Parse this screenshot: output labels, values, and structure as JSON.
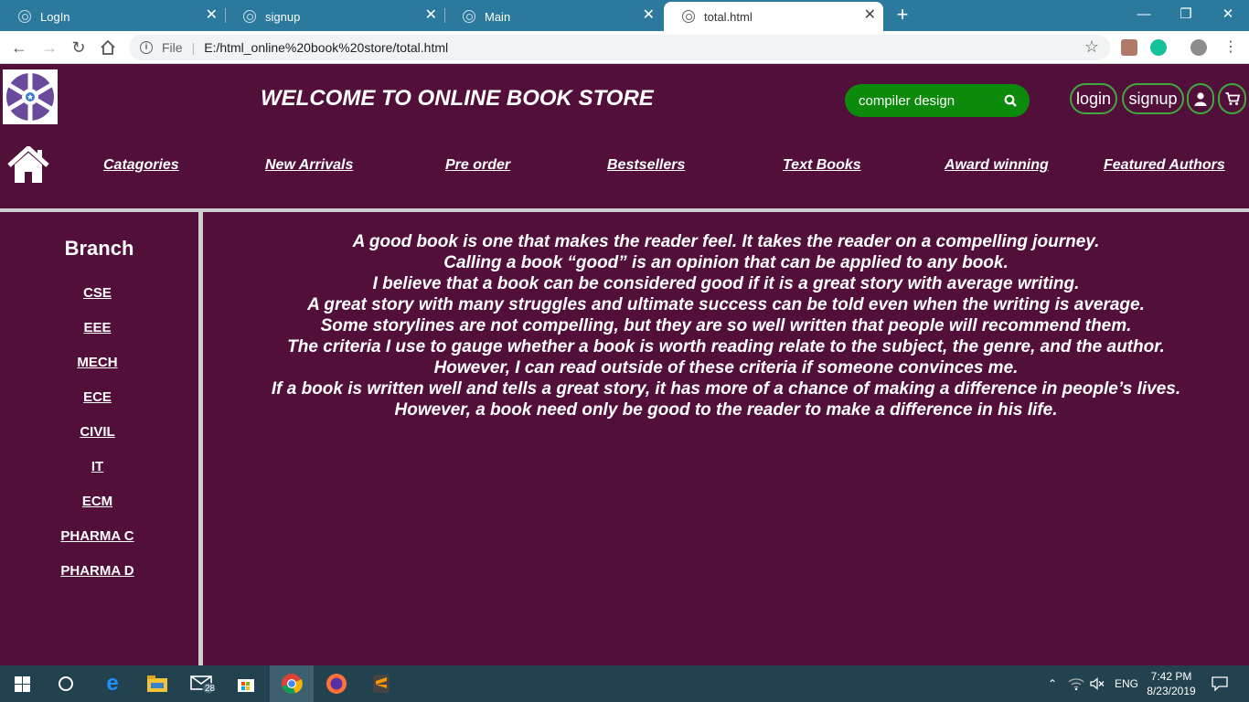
{
  "browser": {
    "tabs": [
      {
        "title": "LogIn",
        "active": false
      },
      {
        "title": "signup",
        "active": false
      },
      {
        "title": "Main",
        "active": false
      },
      {
        "title": "total.html",
        "active": true
      }
    ],
    "address": {
      "protocol_label": "File",
      "url": "E:/html_online%20book%20store/total.html"
    }
  },
  "header": {
    "title": "WELCOME TO ONLINE BOOK STORE",
    "search_value": "compiler design",
    "login_label": "login",
    "signup_label": "signup"
  },
  "nav": {
    "items": [
      {
        "label": "Catagories"
      },
      {
        "label": "New Arrivals"
      },
      {
        "label": "Pre order"
      },
      {
        "label": "Bestsellers"
      },
      {
        "label": "Text Books"
      },
      {
        "label": "Award winning"
      },
      {
        "label": "Featured Authors"
      }
    ]
  },
  "sidebar": {
    "title": "Branch",
    "items": [
      {
        "label": "CSE"
      },
      {
        "label": "EEE"
      },
      {
        "label": "MECH"
      },
      {
        "label": "ECE"
      },
      {
        "label": "CIVIL"
      },
      {
        "label": "IT"
      },
      {
        "label": "ECM"
      },
      {
        "label": "PHARMA C"
      },
      {
        "label": "PHARMA D"
      }
    ]
  },
  "main": {
    "lines": [
      "A good book is one that makes the reader feel. It takes the reader on a compelling journey.",
      "Calling a book “good” is an opinion that can be applied to any book.",
      "I believe that a book can be considered good if it is a great story with average writing.",
      "A great story with many struggles and ultimate success can be told even when the writing is average.",
      "Some storylines are not compelling, but they are so well written that people will recommend them.",
      "The criteria I use to gauge whether a book is worth reading relate to the subject, the genre, and the author.",
      "However, I can read outside of these criteria if someone convinces me.",
      "If a book is written well and tells a great story, it has more of a chance of making a difference in people’s lives.",
      "However, a book need only be good to the reader to make a difference in his life."
    ]
  },
  "taskbar": {
    "mail_badge": "28",
    "language": "ENG",
    "time": "7:42 PM",
    "date": "8/23/2019"
  },
  "colors": {
    "page_bg": "#520f3a",
    "search_bg": "#0c8a0c",
    "tab_strip": "#2b7a9e",
    "taskbar": "#23424f"
  }
}
